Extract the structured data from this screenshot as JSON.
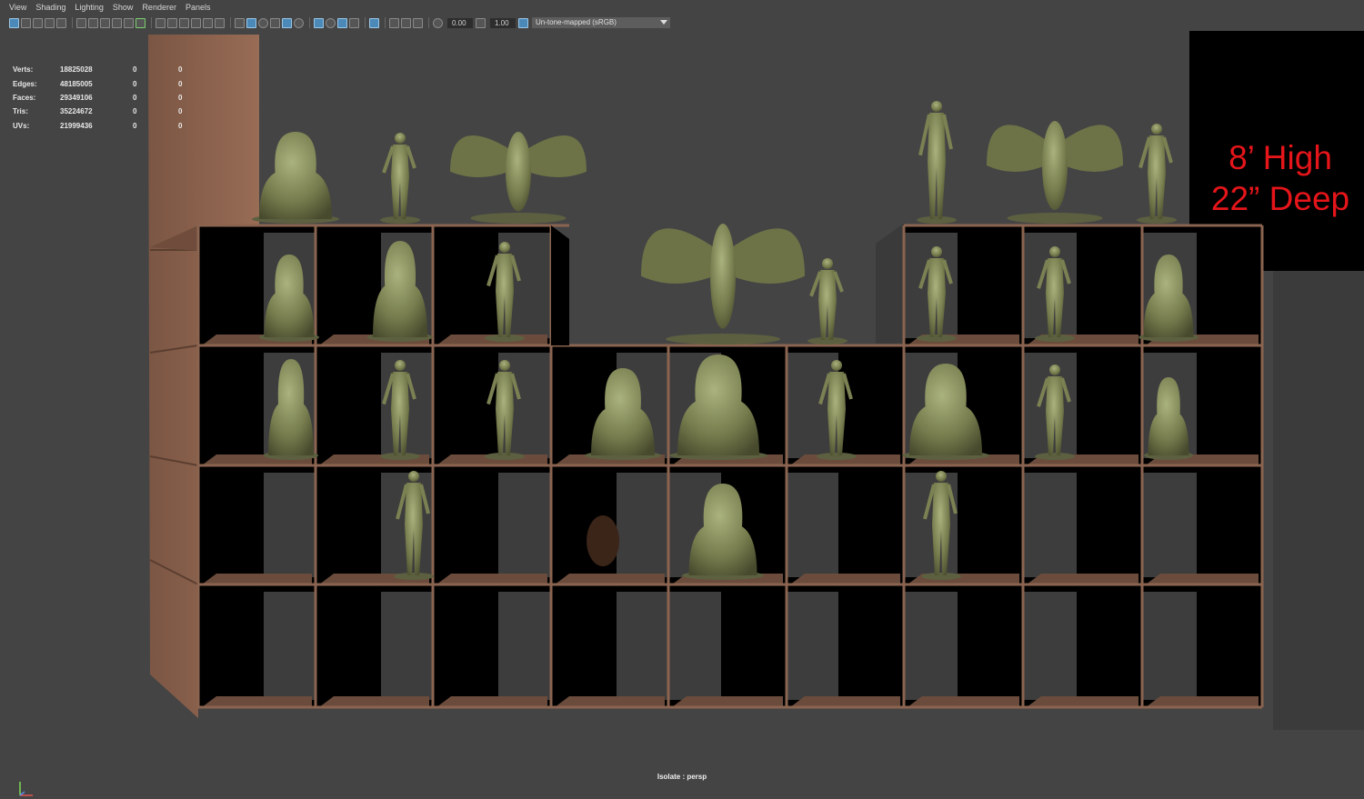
{
  "menu": [
    "View",
    "Shading",
    "Lighting",
    "Show",
    "Renderer",
    "Panels"
  ],
  "toolbar": {
    "exposure_value": "0.00",
    "gamma_value": "1.00",
    "color_space": "Un-tone-mapped (sRGB)"
  },
  "hud": {
    "rows": [
      {
        "label": "Verts:",
        "value": "18825028",
        "sel": "0",
        "comp": "0"
      },
      {
        "label": "Edges:",
        "value": "48185005",
        "sel": "0",
        "comp": "0"
      },
      {
        "label": "Faces:",
        "value": "29349106",
        "sel": "0",
        "comp": "0"
      },
      {
        "label": "Tris:",
        "value": "35224672",
        "sel": "0",
        "comp": "0"
      },
      {
        "label": "UVs:",
        "value": "21999436",
        "sel": "0",
        "comp": "0"
      }
    ]
  },
  "annotation": {
    "line1": "8’ High",
    "line2": "22” Deep"
  },
  "status": {
    "camera": "Isolate : persp"
  },
  "colors": {
    "background": "#444444",
    "wood": "#8a6450",
    "cubby": "#000000",
    "sculpture": "#7b8152",
    "annotation": "#e5151a"
  }
}
